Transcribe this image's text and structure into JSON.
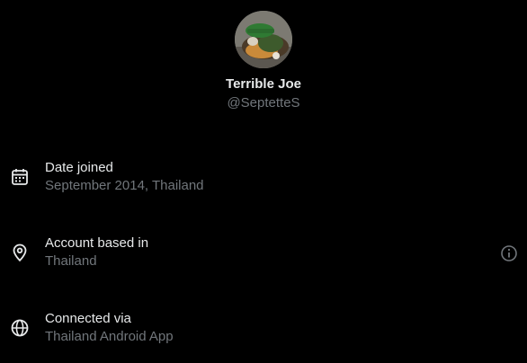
{
  "profile": {
    "display_name": "Terrible Joe",
    "handle": "@SeptetteS"
  },
  "rows": [
    {
      "label": "Date joined",
      "value": "September 2014, Thailand",
      "icon": "calendar-icon"
    },
    {
      "label": "Account based in",
      "value": "Thailand",
      "icon": "location-pin-icon"
    },
    {
      "label": "Connected via",
      "value": "Thailand Android App",
      "icon": "globe-icon"
    }
  ],
  "colors": {
    "background": "#000000",
    "primary_text": "#e7e9ea",
    "secondary_text": "#71767b"
  }
}
